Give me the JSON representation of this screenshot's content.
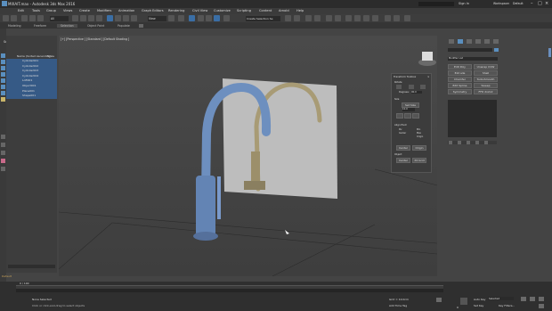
{
  "window": {
    "title": "MIXAIT.max - Autodesk 3ds Max 2016",
    "controls": [
      "–",
      "□",
      "×"
    ],
    "sign_in": "Sign In",
    "workspace_label": "Workspace:",
    "workspace_value": "Default"
  },
  "menus": [
    "Edit",
    "Tools",
    "Group",
    "Views",
    "Create",
    "Modifiers",
    "Animation",
    "Graph Editors",
    "Rendering",
    "Civil View",
    "Customize",
    "Scripting",
    "Content",
    "Arnold",
    "Help"
  ],
  "toolbar": {
    "filter": "All",
    "view_dropdown": "View",
    "selection_set": "Create Selection Se"
  },
  "ribbon_tabs": [
    "Modeling",
    "Freeform",
    "Selection",
    "Object Paint",
    "Populate"
  ],
  "scene_explorer": {
    "tabs": [
      "Select",
      "Display",
      "Edit"
    ],
    "column_name": "Name (Sorted Ascending)",
    "column_frozen": "Froze",
    "items": [
      "Cylinder001",
      "Cylinder002",
      "Cylinder003",
      "Cylinder004",
      "Loft001",
      "Object001",
      "Plane001",
      "Shape001"
    ]
  },
  "viewport": {
    "label": "[+] [Perspective ] [Standard ] [Default Shading ]"
  },
  "transform_toolbox": {
    "title": "Transform Toolbox",
    "rotate_label": "Rotate",
    "degrees_label": "Degrees:",
    "degrees_value": "90.0",
    "size_label": "Size",
    "set_size": "Set Size",
    "size_value": "10.0",
    "align_pivot_label": "Align Pivot",
    "pivot_options": [
      "Piv",
      "Min",
      "Center",
      "Max",
      "Origin"
    ],
    "buttons": [
      "Center",
      "Origin"
    ],
    "object_label": "Object",
    "object_buttons": [
      "Center",
      "X0 Grid"
    ]
  },
  "command_panel": {
    "modifier_list": "Modifier List",
    "buttons": [
      "Edit Poly",
      "Unwrap UVW",
      "Extrude",
      "Shell",
      "Chamfer",
      "TurboSmooth",
      "Edit Spline",
      "Sweep",
      "Symmetry",
      "FFD 2x2x2"
    ]
  },
  "timeline": {
    "frame_display": "0 / 100"
  },
  "status": {
    "selection": "None Selected",
    "prompt": "Click or click-and-drag to select objects",
    "grid": "Grid = 10.0cm",
    "add_time_tag": "Add Time Tag",
    "auto_key": "Auto Key",
    "selected": "Selected",
    "set_key": "Set Key",
    "key_filters": "Key Filters...",
    "frame": "0",
    "maxscript": "Default"
  },
  "colors": {
    "faucet_blue": "#6d8fbf",
    "faucet_brass": "#a89b75",
    "panel": "#bdbdbd"
  }
}
